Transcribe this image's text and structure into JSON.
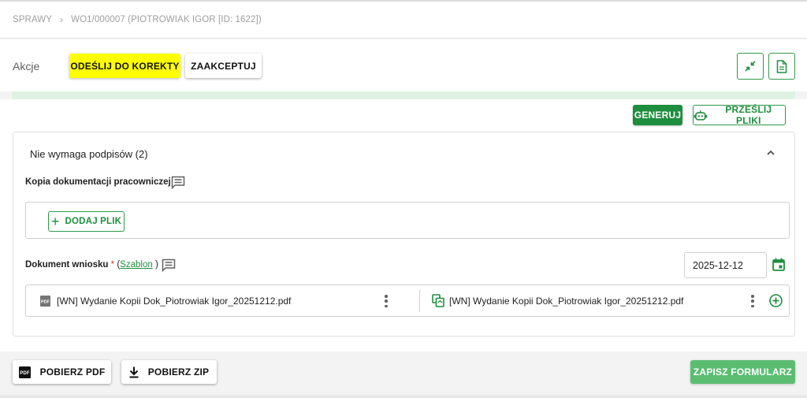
{
  "breadcrumb": {
    "root": "SPRAWY",
    "separator": "›",
    "current": "WO1/000007 (PIOTROWIAK IGOR [ID: 1622])"
  },
  "actions": {
    "label": "Akcje",
    "send_back_label": "ODEŚLIJ DO KOREKTY",
    "accept_label": "ZAAKCEPTUJ"
  },
  "toolbar": {
    "generate_label": "GENERUJ",
    "upload_label": "PRZEŚLIJ PLIKI"
  },
  "panel": {
    "title": "Nie wymaga podpisów (2)",
    "field1": {
      "label": "Kopia dokumentacji pracowniczej",
      "add_file_label": "DODAJ PLIK"
    },
    "field2": {
      "label": "Dokument wniosku",
      "required_mark": "*",
      "paren_open": "(",
      "template_link": "Szablon",
      "paren_close": ")",
      "date": "2025-12-12",
      "file_left": "[WN] Wydanie Kopii Dok_Piotrowiak Igor_20251212.pdf",
      "file_right": "[WN] Wydanie Kopii Dok_Piotrowiak Igor_20251212.pdf"
    }
  },
  "footer": {
    "download_pdf_label": "POBIERZ PDF",
    "download_zip_label": "POBIERZ ZIP",
    "save_label": "ZAPISZ FORMULARZ"
  },
  "icons": {
    "pdf_badge": "PDF"
  },
  "colors": {
    "accent_green": "#1e8e3e",
    "highlight_yellow": "#ffff00",
    "save_green": "#5bbd72",
    "strip_green": "#dff2e1"
  }
}
